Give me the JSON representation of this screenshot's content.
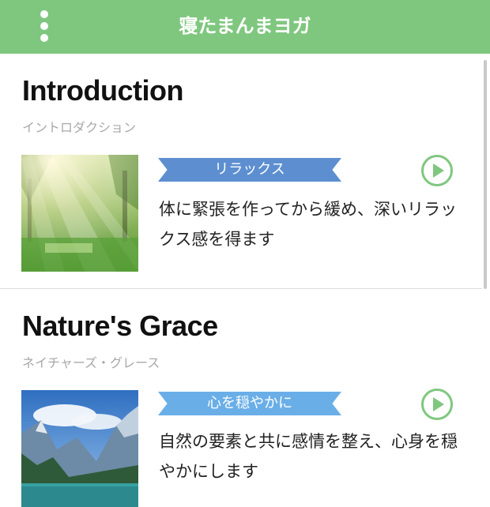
{
  "header": {
    "title": "寝たまんまヨガ",
    "menu_icon": "more-vertical-icon",
    "background_color": "#7fc77f"
  },
  "sessions": [
    {
      "title": "Introduction",
      "subtitle": "イントロダクション",
      "tag": "リラックス",
      "tag_color": "#5d8fd0",
      "description": "体に緊張を作ってから緩め、深いリラックス感を得ます",
      "thumbnail": "sunlit-forest-image",
      "play_icon": "play-circle-icon"
    },
    {
      "title": "Nature's Grace",
      "subtitle": "ネイチャーズ・グレース",
      "tag": "心を穏やかに",
      "tag_color": "#6aaee8",
      "description": "自然の要素と共に感情を整え、心身を穏やかにします",
      "thumbnail": "mountain-lake-image",
      "play_icon": "play-circle-icon"
    }
  ],
  "accent_color": "#7fc77f"
}
